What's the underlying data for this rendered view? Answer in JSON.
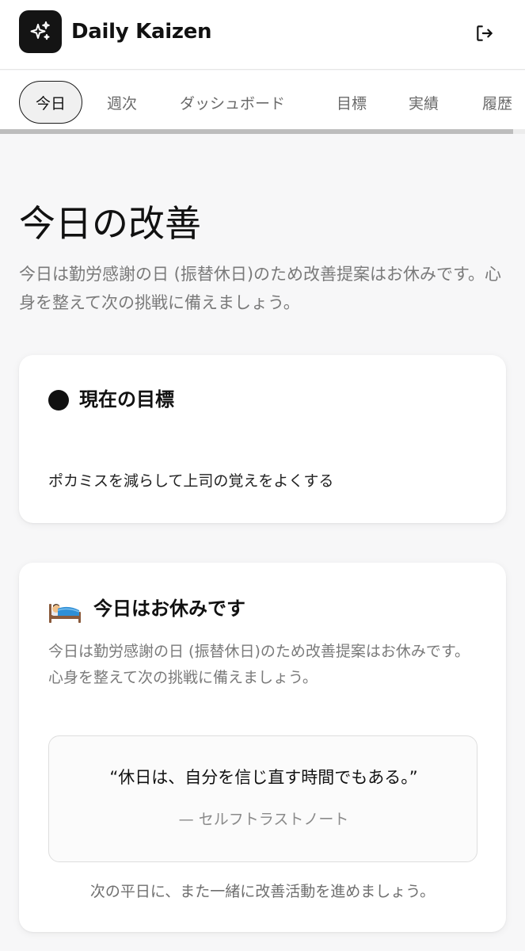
{
  "header": {
    "app_title": "Daily Kaizen",
    "logo_icon": "sparkles-icon",
    "logout_icon": "logout-icon"
  },
  "tabs": [
    {
      "label": "今日",
      "active": true
    },
    {
      "label": "週次",
      "active": false
    },
    {
      "label": "ダッシュボード",
      "active": false
    },
    {
      "label": "目標",
      "active": false
    },
    {
      "label": "実績",
      "active": false
    },
    {
      "label": "履歴",
      "active": false
    }
  ],
  "page": {
    "title": "今日の改善",
    "subtitle": "今日は勤労感謝の日 (振替休日)のため改善提案はお休みです。心身を整えて次の挑戦に備えましょう。"
  },
  "goal_card": {
    "heading": "現在の目標",
    "text": "ポカミスを減らして上司の覚えをよくする"
  },
  "rest_card": {
    "icon": "sleeping-in-bed-icon",
    "heading": "今日はお休みです",
    "description": "今日は勤労感謝の日 (振替休日)のため改善提案はお休みです。心身を整えて次の挑戦に備えましょう。",
    "quote": "“休日は、自分を信じ直す時間でもある。”",
    "quote_source": "— セルフトラストノート",
    "footer": "次の平日に、また一緒に改善活動を進めましょう。"
  },
  "colors": {
    "accent": "#141414",
    "background": "#f7f7f8",
    "muted_text": "#7a7a7a"
  }
}
